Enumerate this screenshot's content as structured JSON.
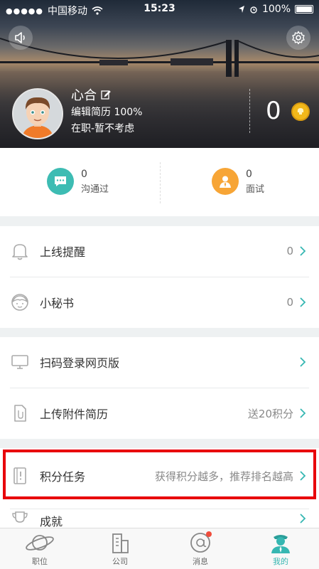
{
  "status_bar": {
    "carrier": "中国移动",
    "time": "15:23",
    "battery": "100%"
  },
  "header": {
    "speaker_icon": "speaker-icon",
    "settings_icon": "gear-icon",
    "name": "心合",
    "resume_completeness": "编辑简历 100%",
    "job_status": "在职-暂不考虑",
    "points": "0"
  },
  "stats": [
    {
      "count": "0",
      "label": "沟通过",
      "color": "#3dbcb3"
    },
    {
      "count": "0",
      "label": "面试",
      "color": "#f7a536"
    }
  ],
  "menu": {
    "online_reminder": {
      "label": "上线提醒",
      "value": "0"
    },
    "assistant": {
      "label": "小秘书",
      "value": "0"
    },
    "scan_login": {
      "label": "扫码登录网页版",
      "value": ""
    },
    "upload_resume": {
      "label": "上传附件简历",
      "value": "送20积分"
    },
    "points_tasks": {
      "label": "积分任务",
      "value": "获得积分越多，推荐排名越高"
    },
    "achievements": {
      "label": "成就",
      "value": ""
    }
  },
  "tabbar": [
    {
      "label": "职位",
      "icon": "planet-icon"
    },
    {
      "label": "公司",
      "icon": "building-icon"
    },
    {
      "label": "消息",
      "icon": "at-icon"
    },
    {
      "label": "我的",
      "icon": "profile-icon"
    }
  ],
  "colors": {
    "accent": "#36b7b2",
    "highlight": "#e8000a"
  }
}
